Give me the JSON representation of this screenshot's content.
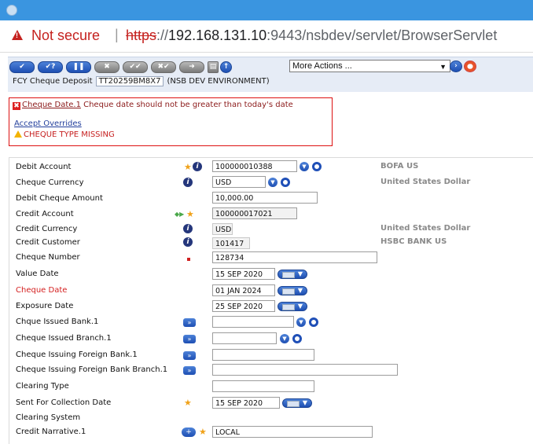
{
  "browser": {
    "security_label": "Not secure",
    "separator": "|",
    "url_scheme": "https",
    "url_sep": "://",
    "url_host": "192.168.131.10",
    "url_rest": ":9443/nsbdev/servlet/BrowserServlet"
  },
  "toolbar": {
    "actions_value": "More Actions ...",
    "deal_title": "FCY Cheque Deposit",
    "deal_id": "TT20259BM8X7",
    "environment": "(NSB DEV ENVIRONMENT)"
  },
  "messages": {
    "error_field": "Cheque Date.1",
    "error_text": " Cheque date should not be greater than today's date",
    "accept_overrides": "Accept Overrides",
    "warning_text": "CHEQUE TYPE MISSING"
  },
  "form": {
    "debit_account": {
      "label": "Debit Account",
      "value": "100000010388",
      "enrichment": "BOFA US"
    },
    "cheque_currency": {
      "label": "Cheque Currency",
      "value": "USD",
      "enrichment": "United States Dollar"
    },
    "debit_cheque_amount": {
      "label": "Debit Cheque Amount",
      "value": "10,000.00"
    },
    "credit_account": {
      "label": "Credit Account",
      "value": "100000017021"
    },
    "credit_currency": {
      "label": "Credit Currency",
      "value": "USD",
      "enrichment": "United States Dollar"
    },
    "credit_customer": {
      "label": "Credit Customer",
      "value": "101417",
      "enrichment": "HSBC BANK US"
    },
    "cheque_number": {
      "label": "Cheque Number",
      "value": "128734"
    },
    "value_date": {
      "label": "Value Date",
      "value": "15 SEP 2020"
    },
    "cheque_date": {
      "label": "Cheque Date",
      "value": "01 JAN 2024"
    },
    "exposure_date": {
      "label": "Exposure Date",
      "value": "25 SEP 2020"
    },
    "cheque_issued_bank": {
      "label": "Chque Issued Bank.1",
      "value": ""
    },
    "cheque_issued_branch": {
      "label": "Cheque Issued Branch.1",
      "value": ""
    },
    "cheque_issuing_foreign_bank": {
      "label": "Cheque Issuing Foreign Bank.1",
      "value": ""
    },
    "cheque_issuing_foreign_branch": {
      "label": "Cheque Issuing Foreign Bank Branch.1",
      "value": ""
    },
    "clearing_type": {
      "label": "Clearing Type",
      "value": ""
    },
    "sent_for_collection_date": {
      "label": "Sent For Collection Date",
      "value": "15 SEP 2020"
    },
    "clearing_system": {
      "label": "Clearing System"
    },
    "credit_narrative": {
      "label": "Credit Narrative.1",
      "value": "LOCAL"
    }
  },
  "colors": {
    "titlebar": "#3a95e0",
    "error_red": "#d11111",
    "button_blue": "#1e4fb3"
  }
}
